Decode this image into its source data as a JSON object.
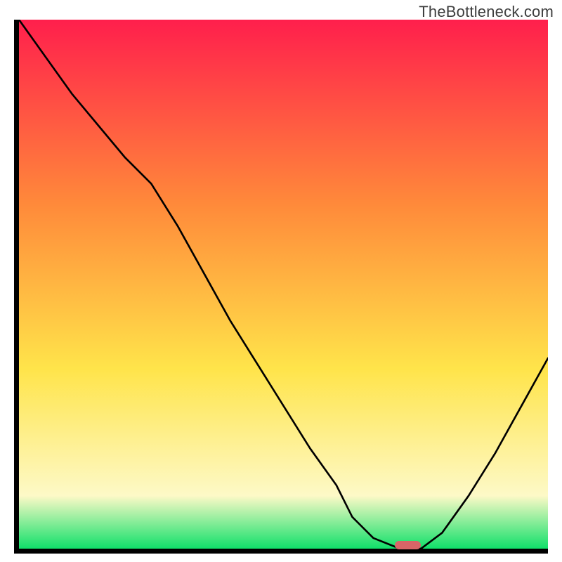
{
  "watermark": "TheBottleneck.com",
  "colors": {
    "gradient_top": "#ff1f4c",
    "gradient_mid_warm": "#ff8a3a",
    "gradient_mid_yellow": "#ffe44a",
    "gradient_pale": "#fdf9c7",
    "gradient_green": "#10e06a",
    "curve": "#000000",
    "axis": "#000000",
    "marker": "#d96567"
  },
  "chart_data": {
    "type": "line",
    "title": "",
    "xlabel": "",
    "ylabel": "",
    "xlim": [
      0,
      100
    ],
    "ylim": [
      0,
      100
    ],
    "series": [
      {
        "name": "bottleneck-curve",
        "x": [
          0,
          5,
          10,
          15,
          20,
          25,
          30,
          35,
          40,
          45,
          50,
          55,
          60,
          63,
          67,
          72,
          76,
          80,
          85,
          90,
          95,
          100
        ],
        "y": [
          100,
          93,
          86,
          80,
          74,
          69,
          61,
          52,
          43,
          35,
          27,
          19,
          12,
          6,
          2,
          0,
          0,
          3,
          10,
          18,
          27,
          36
        ]
      }
    ],
    "marker": {
      "x": 73.5,
      "y": 0.7,
      "w": 5,
      "h": 1.6
    }
  }
}
